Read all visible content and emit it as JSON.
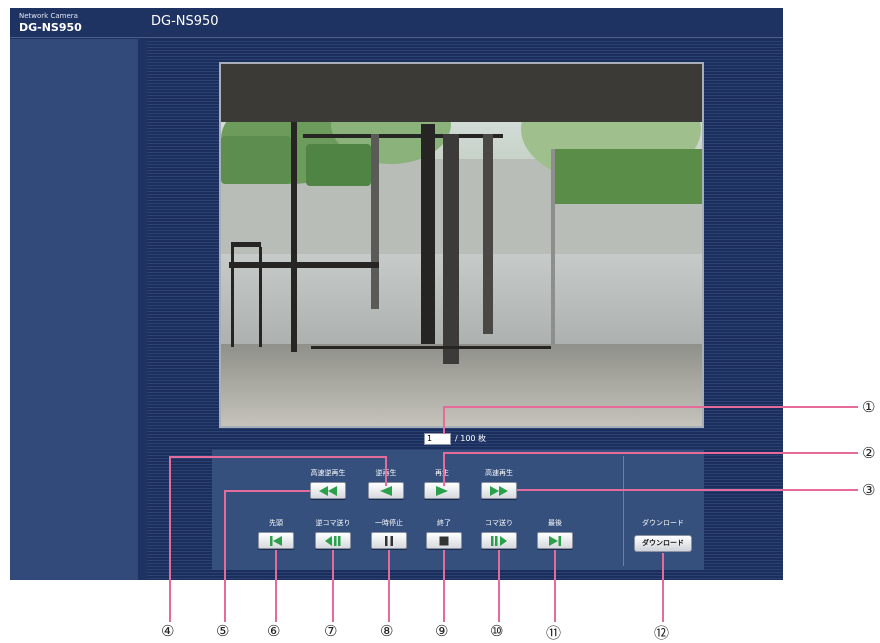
{
  "header": {
    "brand_small": "Network Camera",
    "brand_model": "DG-NS950",
    "title": "DG-NS950"
  },
  "image": {
    "description_icon": "camera-snapshot"
  },
  "counter": {
    "current_value": "1",
    "total_label": "/ 100 枚"
  },
  "controls": {
    "row1": [
      {
        "id": "fast-reverse",
        "label": "高速逆再生",
        "icon": "double-left-triangle-icon"
      },
      {
        "id": "reverse",
        "label": "逆再生",
        "icon": "left-triangle-icon"
      },
      {
        "id": "play",
        "label": "再生",
        "icon": "right-triangle-icon"
      },
      {
        "id": "fast-play",
        "label": "高速再生",
        "icon": "double-right-triangle-icon"
      }
    ],
    "row2": [
      {
        "id": "first",
        "label": "先頭",
        "icon": "skip-first-icon"
      },
      {
        "id": "frame-back",
        "label": "逆コマ送り",
        "icon": "frame-back-icon"
      },
      {
        "id": "pause",
        "label": "一時停止",
        "icon": "pause-icon"
      },
      {
        "id": "stop",
        "label": "終了",
        "icon": "stop-icon"
      },
      {
        "id": "frame-forward",
        "label": "コマ送り",
        "icon": "frame-forward-icon"
      },
      {
        "id": "last",
        "label": "最後",
        "icon": "skip-last-icon"
      }
    ],
    "download": {
      "label": "ダウンロード",
      "button": "ダウンロード"
    }
  },
  "callouts": [
    "①",
    "②",
    "③",
    "④",
    "⑤",
    "⑥",
    "⑦",
    "⑧",
    "⑨",
    "⑩",
    "⑪",
    "⑫"
  ],
  "colors": {
    "frame_bg": "#1f3363",
    "sidebar_bg": "#324a7a",
    "icon_green": "#2aa04a",
    "callout_line": "#e56c9a"
  }
}
